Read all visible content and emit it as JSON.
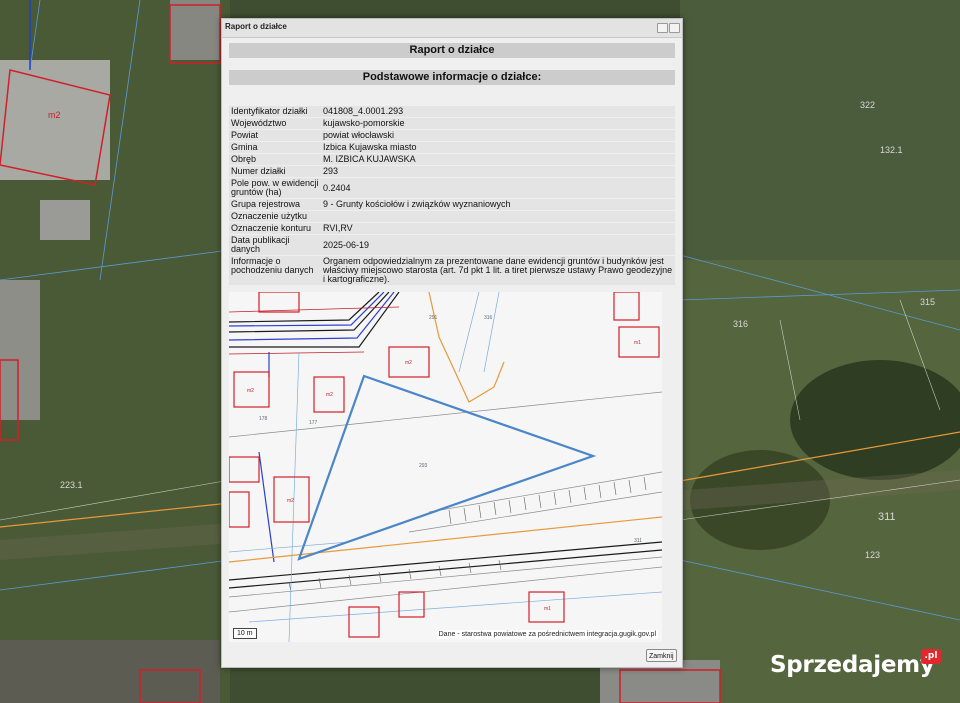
{
  "dialog": {
    "window_title": "Raport o działce",
    "report_header": "Raport o działce",
    "section_header": "Podstawowe informacje o działce:",
    "close_label": "Zamknij"
  },
  "parcel_info": [
    {
      "label": "Identyfikator działki",
      "value": "041808_4.0001.293"
    },
    {
      "label": "Województwo",
      "value": "kujawsko-pomorskie"
    },
    {
      "label": "Powiat",
      "value": "powiat włocławski"
    },
    {
      "label": "Gmina",
      "value": "Izbica Kujawska miasto"
    },
    {
      "label": "Obręb",
      "value": "M. IZBICA KUJAWSKA"
    },
    {
      "label": "Numer działki",
      "value": "293"
    },
    {
      "label": "Pole pow. w ewidencji gruntów (ha)",
      "value": "0.2404"
    },
    {
      "label": "Grupa rejestrowa",
      "value": "9 - Grunty kościołów i związków wyznaniowych"
    },
    {
      "label": "Oznaczenie użytku",
      "value": ""
    },
    {
      "label": "Oznaczenie konturu",
      "value": "RVI,RV"
    },
    {
      "label": "Data publikacji danych",
      "value": "2025-06-19"
    },
    {
      "label": "Informacje o pochodzeniu danych",
      "value": "Organem odpowiedzialnym za prezentowane dane ewidencji gruntów i budynków jest właściwy miejscowo starosta (art. 7d pkt 1 lit. a tiret pierwsze ustawy Prawo geodezyjne i kartograficzne)."
    }
  ],
  "map": {
    "scale_label": "10 m",
    "attribution": "Dane - starostwa powiatowe za pośrednictwem integracja.gugik.gov.pl",
    "parcel_label": "293",
    "labels": [
      "291",
      "316",
      "177",
      "311",
      "178"
    ]
  },
  "background_map": {
    "labels": [
      "m2",
      "322",
      "132.1",
      "315",
      "311",
      "123",
      "316",
      "223.1"
    ]
  },
  "branding": {
    "logo_text": "Sprzedajemy",
    "logo_badge": ".pl"
  },
  "colors": {
    "parcel_outline": "#4a86c8",
    "building_outline": "#d0202a",
    "utility_line": "#e79a3a",
    "dialog_bg": "#efefef",
    "header_bg": "#cccccc"
  }
}
